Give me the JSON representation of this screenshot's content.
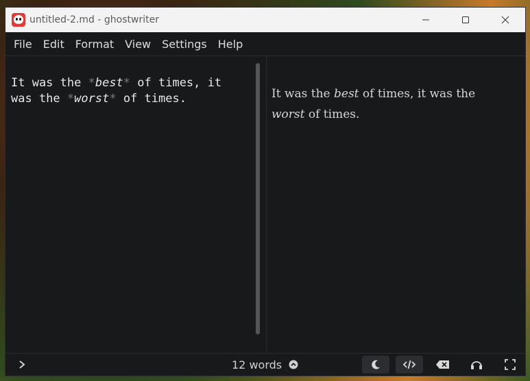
{
  "window": {
    "title": "untitled-2.md - ghostwriter"
  },
  "menu": {
    "items": [
      "File",
      "Edit",
      "Format",
      "View",
      "Settings",
      "Help"
    ]
  },
  "editor": {
    "segments": [
      {
        "text": "It was the ",
        "style": "plain"
      },
      {
        "text": "*",
        "style": "mark"
      },
      {
        "text": "best",
        "style": "em"
      },
      {
        "text": "*",
        "style": "mark"
      },
      {
        "text": " of times, it\nwas the ",
        "style": "plain"
      },
      {
        "text": "*",
        "style": "mark"
      },
      {
        "text": "worst",
        "style": "em"
      },
      {
        "text": "*",
        "style": "mark"
      },
      {
        "text": " of times.",
        "style": "plain"
      }
    ]
  },
  "preview": {
    "segments": [
      {
        "text": "It was the ",
        "style": "plain"
      },
      {
        "text": "best",
        "style": "em"
      },
      {
        "text": " of times, it was the ",
        "style": "plain"
      },
      {
        "text": "worst",
        "style": "em"
      },
      {
        "text": " of times.",
        "style": "plain"
      }
    ]
  },
  "status": {
    "word_count": "12 words",
    "icons": [
      "chevron-right-icon",
      "chevron-up-circle-icon",
      "moon-icon",
      "code-icon",
      "backspace-icon",
      "headphones-icon",
      "fullscreen-icon"
    ]
  },
  "colors": {
    "background": "#18191b",
    "text": "#e8e8e8",
    "markdown_markers": "#7a7a7a",
    "titlebar": "#f3f3f3",
    "active_button": "#2c2d31"
  }
}
